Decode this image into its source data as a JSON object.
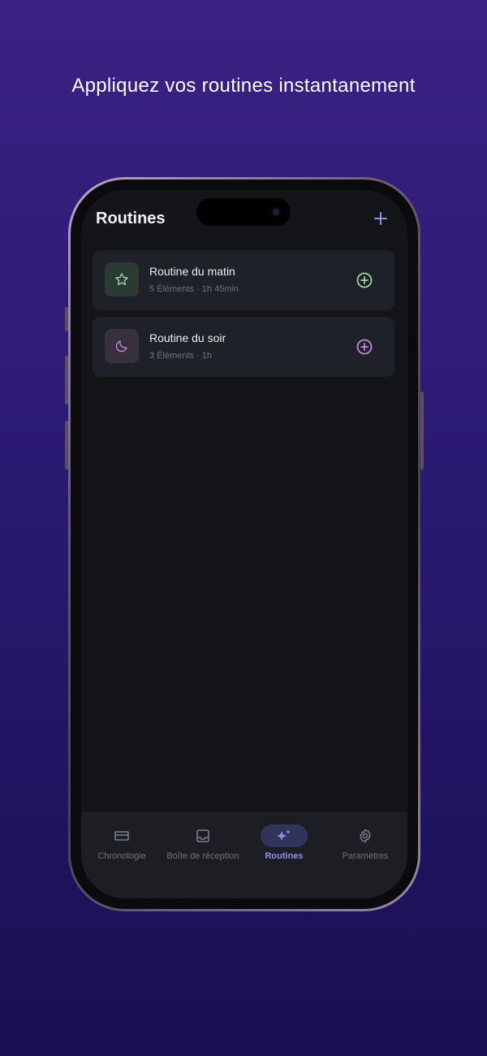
{
  "headline": "Appliquez vos routines instantanement",
  "app": {
    "title": "Routines",
    "add_icon": "plus-icon"
  },
  "routines": [
    {
      "title": "Routine du matin",
      "meta": "5 Éléments · 1h 45min",
      "icon": "star-icon",
      "accent": "#9fd3a6"
    },
    {
      "title": "Routine du soir",
      "meta": "3 Éléments · 1h",
      "icon": "moon-icon",
      "accent": "#c58bd8"
    }
  ],
  "tabs": [
    {
      "label": "Chronologie",
      "icon": "timeline-icon",
      "active": false
    },
    {
      "label": "Boîte de réception",
      "icon": "inbox-icon",
      "active": false
    },
    {
      "label": "Routines",
      "icon": "sparkles-icon",
      "active": true
    },
    {
      "label": "Paramètres",
      "icon": "gear-icon",
      "active": false
    }
  ],
  "colors": {
    "accent": "#8d8ff5",
    "card_bg": "#1e2127",
    "screen_bg": "#141518"
  }
}
